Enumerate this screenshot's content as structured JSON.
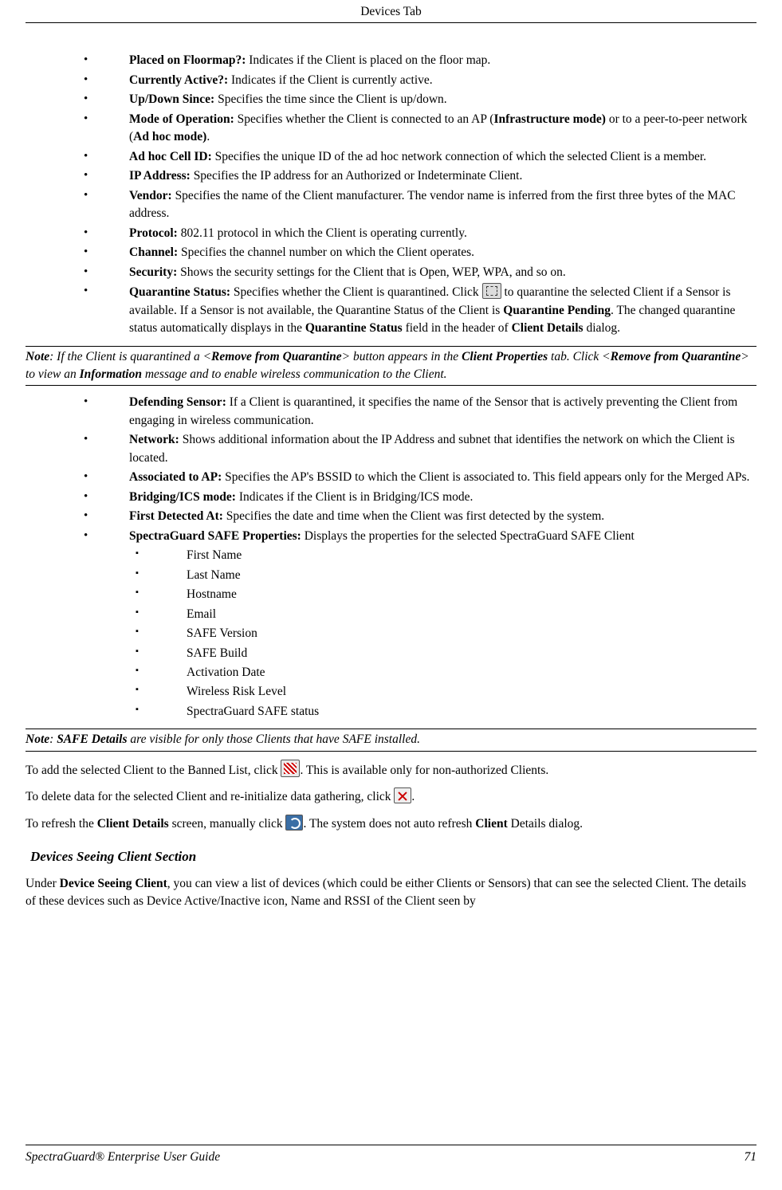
{
  "header": {
    "title": "Devices Tab"
  },
  "list1": [
    {
      "label": "Placed on Floormap?:",
      "text": " Indicates if the Client is placed on the floor map."
    },
    {
      "label": "Currently Active?:",
      "text": " Indicates if the Client is currently active."
    },
    {
      "label": "Up/Down Since:",
      "text": " Specifies the time since the Client is up/down."
    },
    {
      "label": "Mode of Operation:",
      "pre": " Specifies whether the Client is connected to an AP (",
      "b1": "Infrastructure mode)",
      "mid": " or to a peer-to-peer network (",
      "b2": "Ad hoc mode)",
      "post": "."
    },
    {
      "label": "Ad hoc Cell ID:",
      "text": " Specifies the unique ID of the ad hoc network connection of which the selected Client is a member."
    },
    {
      "label": "IP Address:",
      "text": " Specifies the IP address for an Authorized or Indeterminate Client."
    },
    {
      "label": "Vendor:",
      "text": " Specifies the name of the Client manufacturer. The vendor name is inferred from the first three bytes of the MAC address."
    },
    {
      "label": "Protocol:",
      "text": " 802.11 protocol in which the Client is operating currently."
    },
    {
      "label": "Channel:",
      "text": " Specifies the channel number on which the Client operates."
    },
    {
      "label": "Security:",
      "text": " Shows the security settings for the Client that is Open, WEP, WPA, and so on."
    },
    {
      "label": "Quarantine Status:",
      "pre": " Specifies whether the Client is quarantined. Click ",
      "icon": "quarantine-icon",
      "mid2": " to quarantine the selected Client if a Sensor is available. If a Sensor is not available, the Quarantine Status of the Client is ",
      "b3": "Quarantine Pending",
      "mid3": ". The changed quarantine status automatically displays in the ",
      "b4": "Quarantine Status",
      "mid4": " field in the header of ",
      "b5": "Client Details",
      "post": " dialog."
    }
  ],
  "note1": {
    "lead": "Note",
    "t1": ": If the Client is quarantined a <",
    "s1": "Remove from Quarantine",
    "t2": "> button appears in the ",
    "s2": "Client Properties",
    "t3": " tab. Click <",
    "s3": "Remove from Quarantine",
    "t4": "> to view an ",
    "s4": "Information",
    "t5": " message and to enable wireless communication to the Client."
  },
  "list2": [
    {
      "label": "Defending Sensor:",
      "text": " If a Client is quarantined, it specifies the name of the Sensor that is actively preventing the Client from engaging in wireless communication."
    },
    {
      "label": "Network:",
      "text": " Shows additional information about the IP Address and subnet that identifies the network on which the Client is located."
    },
    {
      "label": "Associated to AP:",
      "text": " Specifies the AP's BSSID to which the Client is associated to. This field appears only for the Merged APs."
    },
    {
      "label": "Bridging/ICS mode:",
      "text": " Indicates if the Client is in Bridging/ICS mode."
    },
    {
      "label": "First Detected At:",
      "text": " Specifies the date and time when the Client was first detected by the system."
    },
    {
      "label": "SpectraGuard SAFE Properties:",
      "text": " Displays the properties for the selected SpectraGuard SAFE Client",
      "sub": [
        "First Name",
        "Last Name",
        "Hostname",
        "Email",
        "SAFE Version",
        "SAFE Build",
        "Activation Date",
        "Wireless Risk Level",
        "SpectraGuard SAFE status"
      ]
    }
  ],
  "note2": {
    "lead": "Note",
    "t1": ": ",
    "s1": "SAFE Details",
    "t2": " are visible for only those Clients that have SAFE installed."
  },
  "p_banned": {
    "t1": "To add the selected Client to the Banned List, click ",
    "t2": ". This is available only for non-authorized Clients."
  },
  "p_delete": {
    "t1": " To delete data for the selected Client and re-initialize data gathering, click ",
    "t2": "."
  },
  "p_refresh": {
    "t1": " To refresh the ",
    "b1": "Client Details",
    "t2": " screen, manually click ",
    "t3": ". The system does not auto refresh ",
    "b2": "Client",
    "t4": " Details dialog."
  },
  "section2": {
    "heading": "Devices Seeing Client Section"
  },
  "p_section": {
    "t1": "Under ",
    "b1": "Device Seeing Client",
    "t2": ", you can view a list of devices (which could be either Clients or Sensors) that can see the selected Client. The details of these devices such as Device Active/Inactive icon, Name and RSSI of the Client seen by"
  },
  "footer": {
    "title": "SpectraGuard®  Enterprise User Guide",
    "page": "71"
  }
}
